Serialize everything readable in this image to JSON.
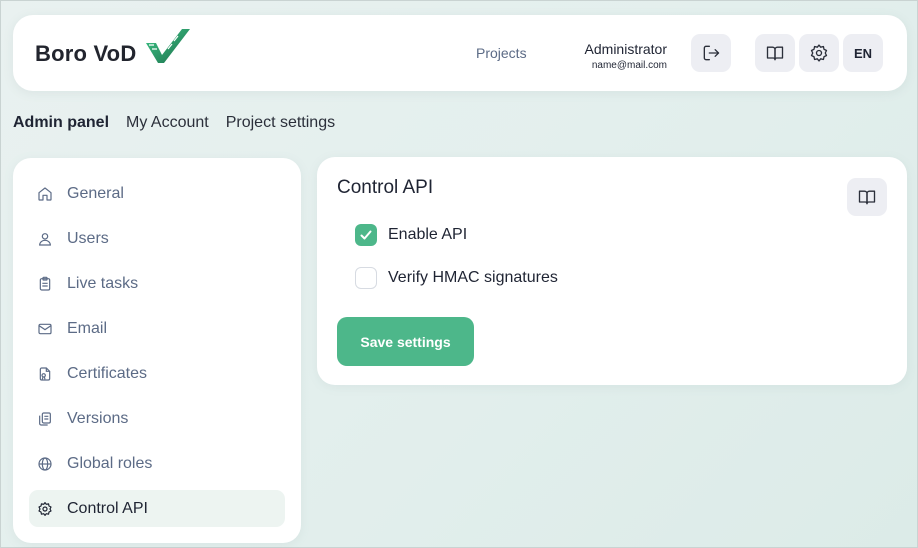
{
  "header": {
    "logo_text": "Boro VoD",
    "nav_projects": "Projects",
    "user_name": "Administrator",
    "user_email": "name@mail.com",
    "lang": "EN",
    "icons": [
      "logout-icon",
      "book-icon",
      "gear-icon"
    ]
  },
  "topnav": {
    "items": [
      {
        "label": "Admin panel",
        "active": true
      },
      {
        "label": "My Account",
        "active": false
      },
      {
        "label": "Project settings",
        "active": false
      }
    ]
  },
  "sidebar": {
    "items": [
      {
        "label": "General",
        "icon": "home-icon"
      },
      {
        "label": "Users",
        "icon": "user-icon"
      },
      {
        "label": "Live tasks",
        "icon": "clipboard-icon"
      },
      {
        "label": "Email",
        "icon": "mail-icon"
      },
      {
        "label": "Certificates",
        "icon": "certificate-icon"
      },
      {
        "label": "Versions",
        "icon": "copy-icon"
      },
      {
        "label": "Global roles",
        "icon": "globe-icon"
      },
      {
        "label": "Control API",
        "icon": "gear-icon",
        "active": true
      }
    ]
  },
  "panel": {
    "title": "Control API",
    "checkboxes": [
      {
        "label": "Enable API",
        "checked": true
      },
      {
        "label": "Verify HMAC signatures",
        "checked": false
      }
    ],
    "save_label": "Save settings"
  },
  "colors": {
    "accent": "#4db78a",
    "muted_text": "#5c6b86",
    "button_bg": "#edeef3"
  }
}
